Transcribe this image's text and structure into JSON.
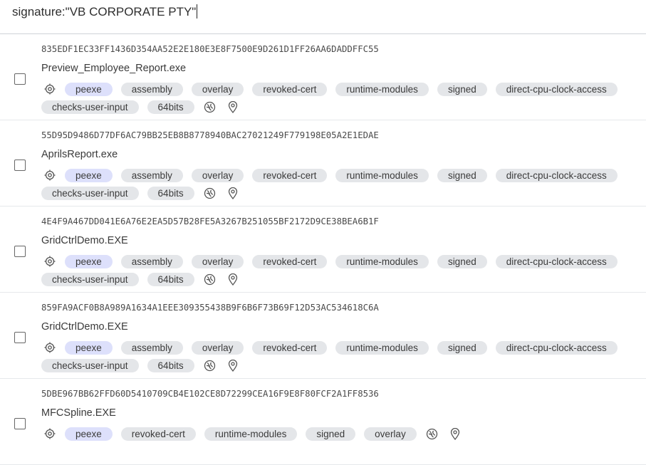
{
  "search": {
    "query": "signature:\"VB CORPORATE PTY\""
  },
  "results": [
    {
      "hash": "835EDF1EC33FF1436D354AA52E2E180E3E8F7500E9D261D1FF26AA6DADDFFC55",
      "name": "Preview_Employee_Report.exe",
      "tags_line1": [
        "peexe",
        "assembly",
        "overlay",
        "revoked-cert",
        "runtime-modules",
        "signed",
        "direct-cpu-clock-access"
      ],
      "tags_line2": [
        "checks-user-input",
        "64bits"
      ]
    },
    {
      "hash": "55D95D9486D77DF6AC79BB25EB8B8778940BAC27021249F779198E05A2E1EDAE",
      "name": "AprilsReport.exe",
      "tags_line1": [
        "peexe",
        "assembly",
        "overlay",
        "revoked-cert",
        "runtime-modules",
        "signed",
        "direct-cpu-clock-access"
      ],
      "tags_line2": [
        "checks-user-input",
        "64bits"
      ]
    },
    {
      "hash": "4E4F9A467DD041E6A76E2EA5D57B28FE5A3267B251055BF2172D9CE38BEA6B1F",
      "name": "GridCtrlDemo.EXE",
      "tags_line1": [
        "peexe",
        "assembly",
        "overlay",
        "revoked-cert",
        "runtime-modules",
        "signed",
        "direct-cpu-clock-access"
      ],
      "tags_line2": [
        "checks-user-input",
        "64bits"
      ]
    },
    {
      "hash": "859FA9ACF0B8A989A1634A1EEE309355438B9F6B6F73B69F12D53AC534618C6A",
      "name": "GridCtrlDemo.EXE",
      "tags_line1": [
        "peexe",
        "assembly",
        "overlay",
        "revoked-cert",
        "runtime-modules",
        "signed",
        "direct-cpu-clock-access"
      ],
      "tags_line2": [
        "checks-user-input",
        "64bits"
      ]
    },
    {
      "hash": "5DBE967BB62FFD60D5410709CB4E102CE8D72299CEA16F9E8F80FCF2A1FF8536",
      "name": "MFCSpline.EXE",
      "tags_line1": [
        "peexe",
        "revoked-cert",
        "runtime-modules",
        "signed",
        "overlay"
      ],
      "tags_line2": []
    }
  ],
  "icons": {
    "type_icon": "crosshair-icon",
    "community_icon": "dna-globe-icon",
    "location_icon": "map-pin-icon"
  },
  "colors": {
    "primary_tag_bg": "#dde0fb",
    "tag_bg": "#e4e6e9",
    "divider": "#e6e8eb"
  }
}
